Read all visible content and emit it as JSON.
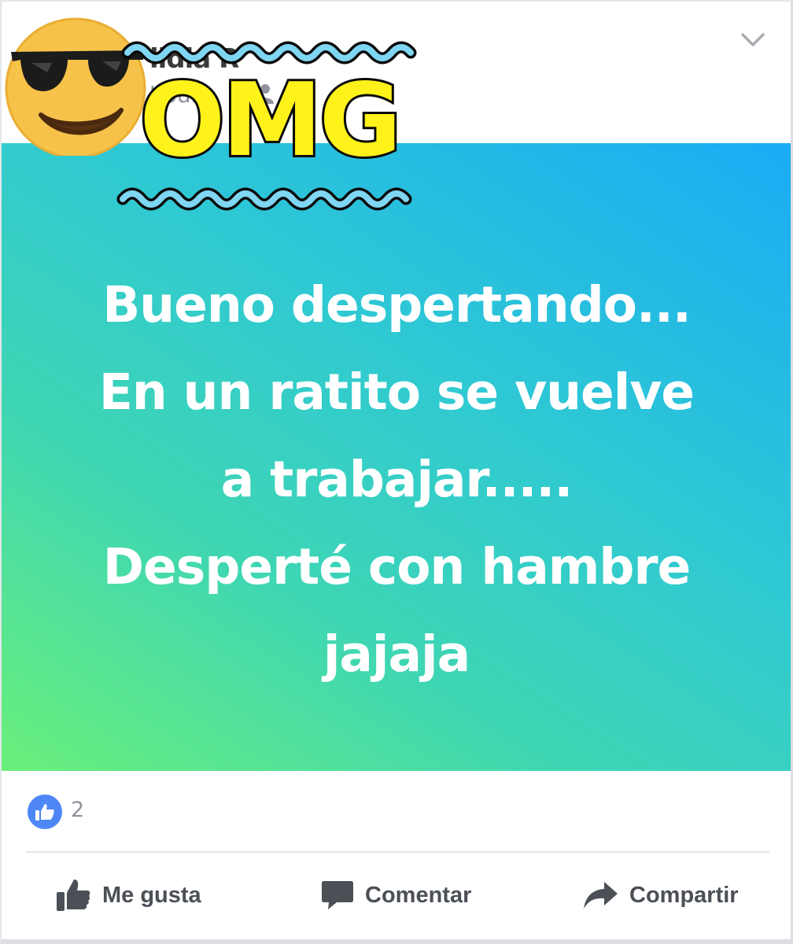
{
  "post": {
    "author_name": "lidia R",
    "timestamp": "hours",
    "text_lines": [
      "Bueno despertando...",
      "En un ratito se vuelve",
      "a trabajar.....",
      "Desperté con hambre",
      "jajaja"
    ],
    "background_gradient": [
      "#6af07a",
      "#3fd6b3",
      "#2fc9d3",
      "#1aabf5"
    ]
  },
  "stickers": {
    "omg_text": "OMG",
    "emoji": "sunglasses-smiley"
  },
  "reactions": {
    "like_count": "2",
    "like_color": "#4e86f5"
  },
  "actions": {
    "like_label": "Me gusta",
    "comment_label": "Comentar",
    "share_label": "Compartir"
  },
  "icons": {
    "menu": "chevron-down-icon",
    "audience": "friends-icon",
    "like": "thumbs-up-icon",
    "comment": "comment-bubble-icon",
    "share": "share-arrow-icon"
  }
}
